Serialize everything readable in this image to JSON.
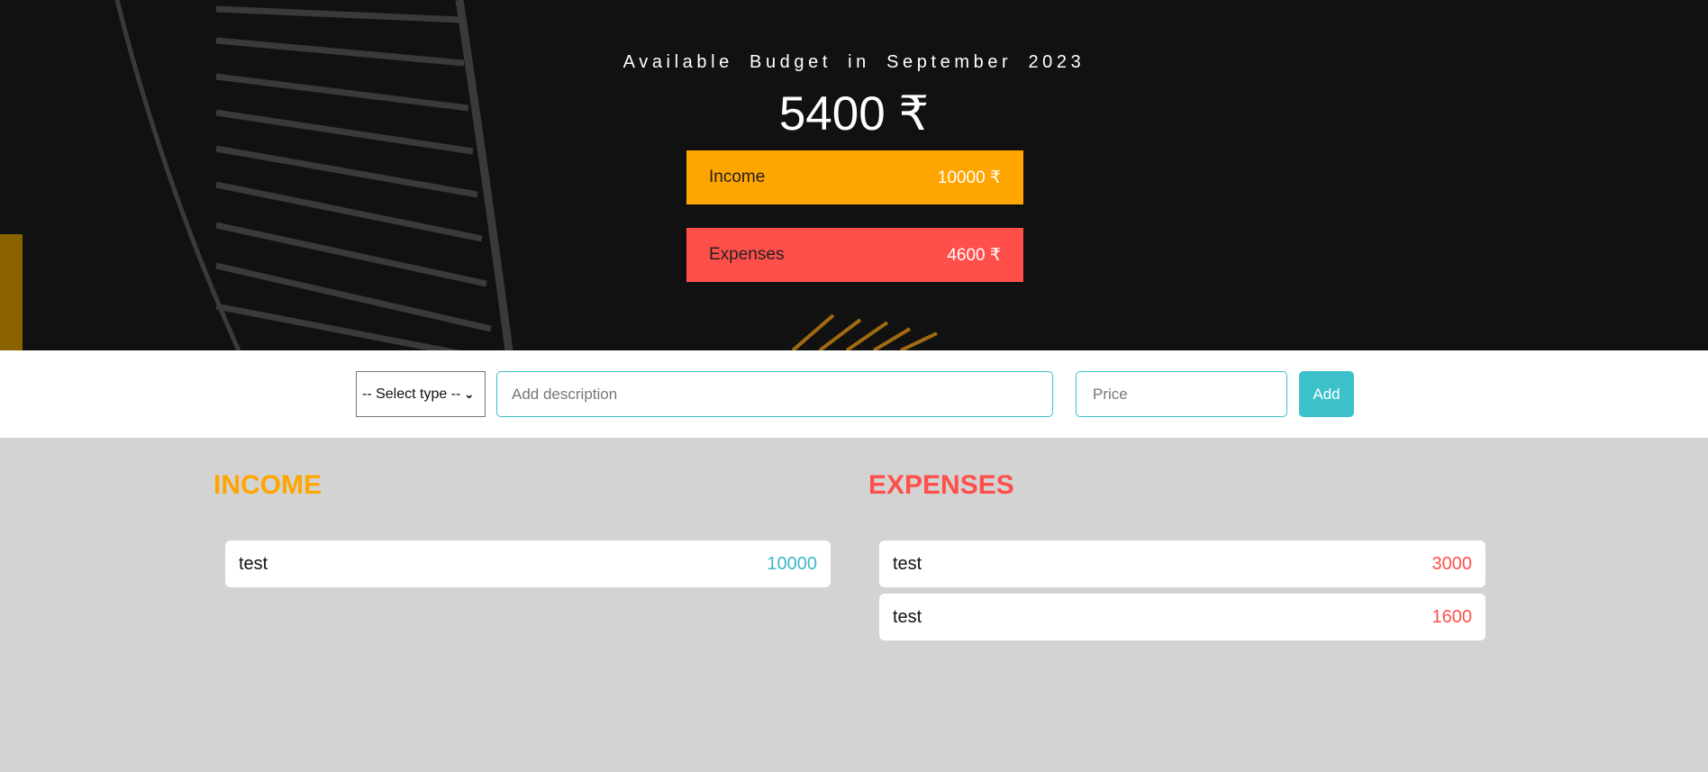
{
  "header": {
    "title": "Available Budget in September 2023",
    "budget": "5400 ₹",
    "income": {
      "label": "Income",
      "value": "10000 ₹",
      "color": "#ffa500"
    },
    "expenses": {
      "label": "Expenses",
      "value": "4600 ₹",
      "color": "#ff4f4b"
    }
  },
  "form": {
    "select_value": "-- Select type --",
    "description_placeholder": "Add description",
    "price_placeholder": "Price",
    "add_label": "Add",
    "accent": "#3cc1cb"
  },
  "income": {
    "heading": "INCOME",
    "items": [
      {
        "desc": "test",
        "amount": "10000"
      }
    ]
  },
  "expenses": {
    "heading": "EXPENSES",
    "items": [
      {
        "desc": "test",
        "amount": "3000"
      },
      {
        "desc": "test",
        "amount": "1600"
      }
    ]
  }
}
